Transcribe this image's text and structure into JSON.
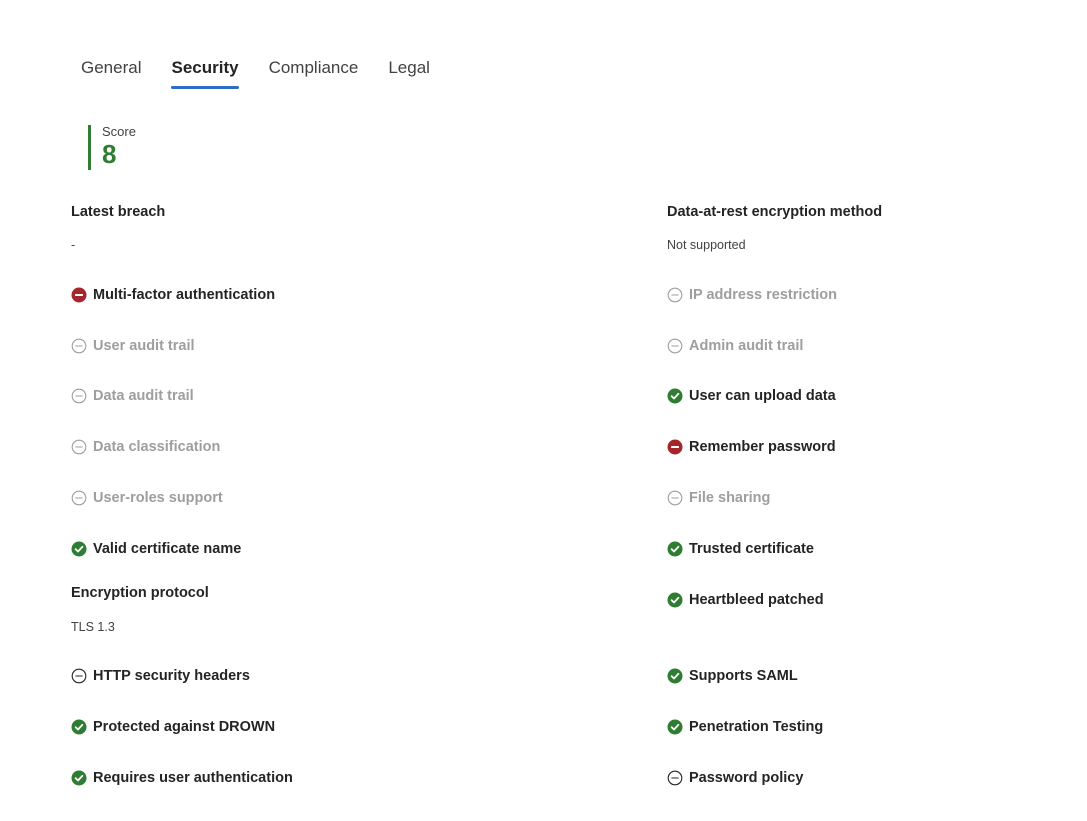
{
  "tabs": [
    {
      "label": "General"
    },
    {
      "label": "Security"
    },
    {
      "label": "Compliance"
    },
    {
      "label": "Legal"
    }
  ],
  "active_tab": "Security",
  "score": {
    "label": "Score",
    "value": "8"
  },
  "left": {
    "latest_breach": {
      "label": "Latest breach",
      "value": "-"
    },
    "encryption_protocol": {
      "label": "Encryption protocol",
      "value": "TLS 1.3"
    },
    "items": [
      {
        "label": "Multi-factor authentication",
        "status": "fail",
        "icon": "minus-circle-filled-icon"
      },
      {
        "label": "User audit trail",
        "status": "not-applicable",
        "icon": "minus-circle-outline-icon"
      },
      {
        "label": "Data audit trail",
        "status": "not-applicable",
        "icon": "minus-circle-outline-icon"
      },
      {
        "label": "Data classification",
        "status": "not-applicable",
        "icon": "minus-circle-outline-icon"
      },
      {
        "label": "User-roles support",
        "status": "not-applicable",
        "icon": "minus-circle-outline-icon"
      },
      {
        "label": "Valid certificate name",
        "status": "pass",
        "icon": "check-circle-icon"
      },
      {
        "label": "HTTP security headers",
        "status": "unknown",
        "icon": "minus-circle-outline-icon"
      },
      {
        "label": "Protected against DROWN",
        "status": "pass",
        "icon": "check-circle-icon"
      },
      {
        "label": "Requires user authentication",
        "status": "pass",
        "icon": "check-circle-icon"
      }
    ]
  },
  "right": {
    "data_at_rest": {
      "label": "Data-at-rest encryption method",
      "value": "Not supported"
    },
    "items": [
      {
        "label": "IP address restriction",
        "status": "not-applicable",
        "icon": "minus-circle-outline-icon"
      },
      {
        "label": "Admin audit trail",
        "status": "not-applicable",
        "icon": "minus-circle-outline-icon"
      },
      {
        "label": "User can upload data",
        "status": "pass",
        "icon": "check-circle-icon"
      },
      {
        "label": "Remember password",
        "status": "fail",
        "icon": "minus-circle-filled-icon"
      },
      {
        "label": "File sharing",
        "status": "not-applicable",
        "icon": "minus-circle-outline-icon"
      },
      {
        "label": "Trusted certificate",
        "status": "pass",
        "icon": "check-circle-icon"
      },
      {
        "label": "Heartbleed patched",
        "status": "pass",
        "icon": "check-circle-icon"
      },
      {
        "label": "Supports SAML",
        "status": "pass",
        "icon": "check-circle-icon"
      },
      {
        "label": "Penetration Testing",
        "status": "pass",
        "icon": "check-circle-icon"
      },
      {
        "label": "Password policy",
        "status": "unknown",
        "icon": "minus-circle-outline-icon"
      }
    ]
  },
  "colors": {
    "pass": "#2e7d32",
    "fail": "#a4262c",
    "not_applicable": "#9e9e9e",
    "unknown": "#242424",
    "tab_underline": "#2f6cc9",
    "score": "#2e7d32"
  }
}
